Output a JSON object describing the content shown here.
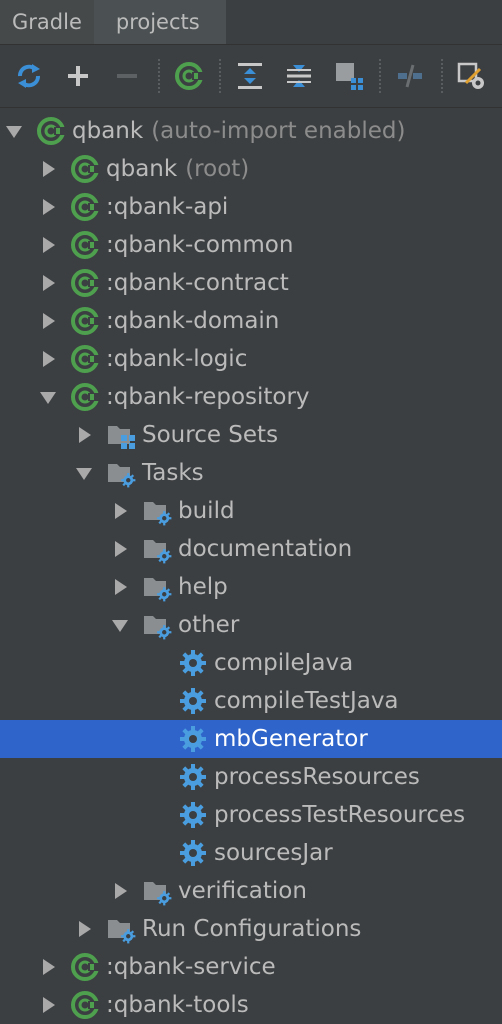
{
  "tabs": [
    {
      "label": "Gradle"
    },
    {
      "label": "projects"
    }
  ],
  "toolbar": {
    "buttons": [
      "refresh-icon",
      "add-icon",
      "remove-icon",
      "gradle-icon",
      "expand-all-icon",
      "collapse-all-icon",
      "group-modules-icon",
      "toggle-offline-icon",
      "settings-icon"
    ]
  },
  "tree": {
    "root": {
      "label": "qbank",
      "suffix": "(auto-import enabled)"
    },
    "items": [
      {
        "label": "qbank",
        "suffix": "(root)"
      },
      {
        "label": ":qbank-api"
      },
      {
        "label": ":qbank-common"
      },
      {
        "label": ":qbank-contract"
      },
      {
        "label": ":qbank-domain"
      },
      {
        "label": ":qbank-logic"
      },
      {
        "label": ":qbank-repository"
      },
      {
        "label": "Source Sets"
      },
      {
        "label": "Tasks"
      },
      {
        "label": "build"
      },
      {
        "label": "documentation"
      },
      {
        "label": "help"
      },
      {
        "label": "other"
      },
      {
        "label": "compileJava"
      },
      {
        "label": "compileTestJava"
      },
      {
        "label": "mbGenerator"
      },
      {
        "label": "processResources"
      },
      {
        "label": "processTestResources"
      },
      {
        "label": "sourcesJar"
      },
      {
        "label": "verification"
      },
      {
        "label": "Run Configurations"
      },
      {
        "label": ":qbank-service"
      },
      {
        "label": ":qbank-tools"
      }
    ]
  },
  "colors": {
    "background": "#3c3f41",
    "selection": "#2f65ca",
    "gradle_green": "#4ea04e",
    "gear_blue": "#4a9ee0",
    "text": "#bbbbbb"
  }
}
